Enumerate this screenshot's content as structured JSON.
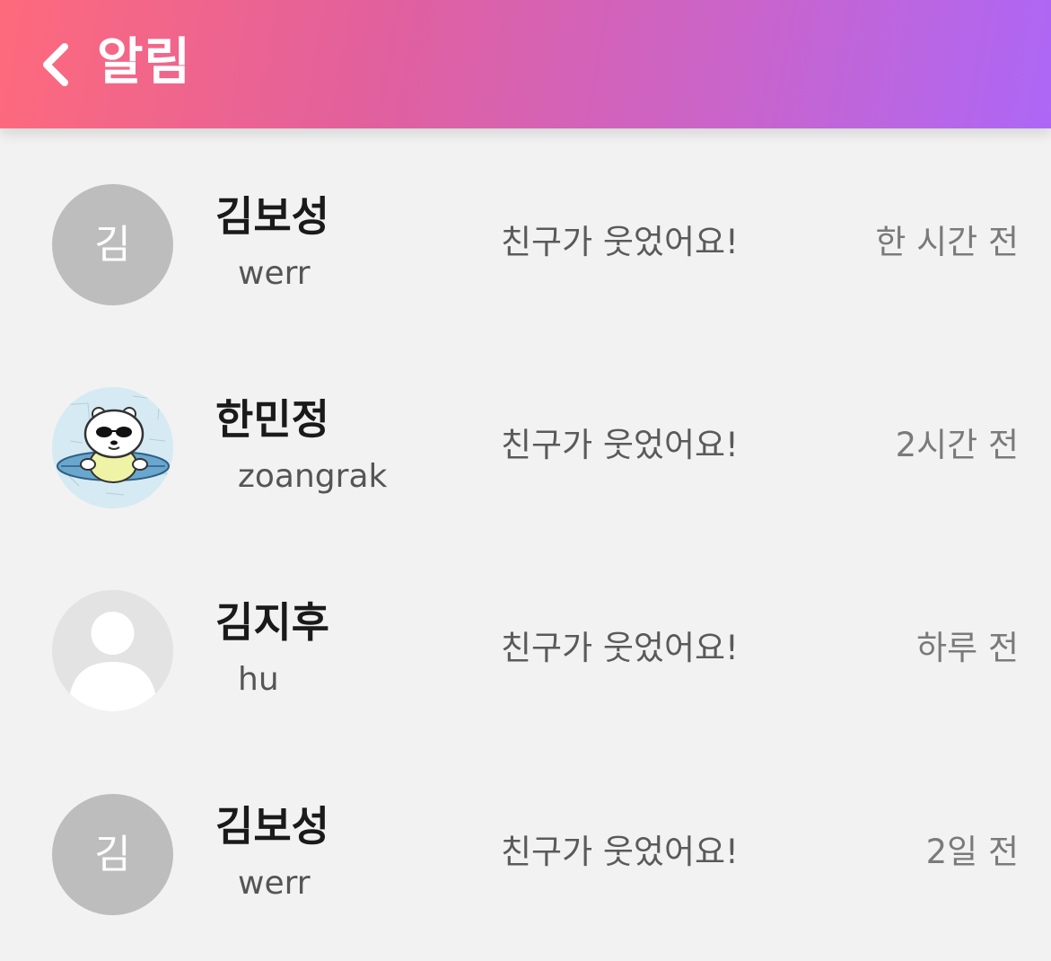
{
  "header": {
    "title": "알림",
    "back_icon": "chevron-left-icon",
    "gradient": [
      "#fe6a7c",
      "#e2609c",
      "#c964cb",
      "#ad67f6"
    ]
  },
  "notifications": [
    {
      "avatar_type": "initial",
      "avatar_initial": "김",
      "name": "김보성",
      "username": "werr",
      "message": "친구가 웃었어요!",
      "time": "한 시간 전"
    },
    {
      "avatar_type": "photo",
      "avatar_initial": "",
      "name": "한민정",
      "username": "zoangrak",
      "message": "친구가 웃었어요!",
      "time": "2시간 전"
    },
    {
      "avatar_type": "default",
      "avatar_initial": "",
      "name": "김지후",
      "username": "hu",
      "message": "친구가 웃었어요!",
      "time": "하루 전"
    },
    {
      "avatar_type": "initial",
      "avatar_initial": "김",
      "name": "김보성",
      "username": "werr",
      "message": "친구가 웃었어요!",
      "time": "2일 전"
    }
  ]
}
